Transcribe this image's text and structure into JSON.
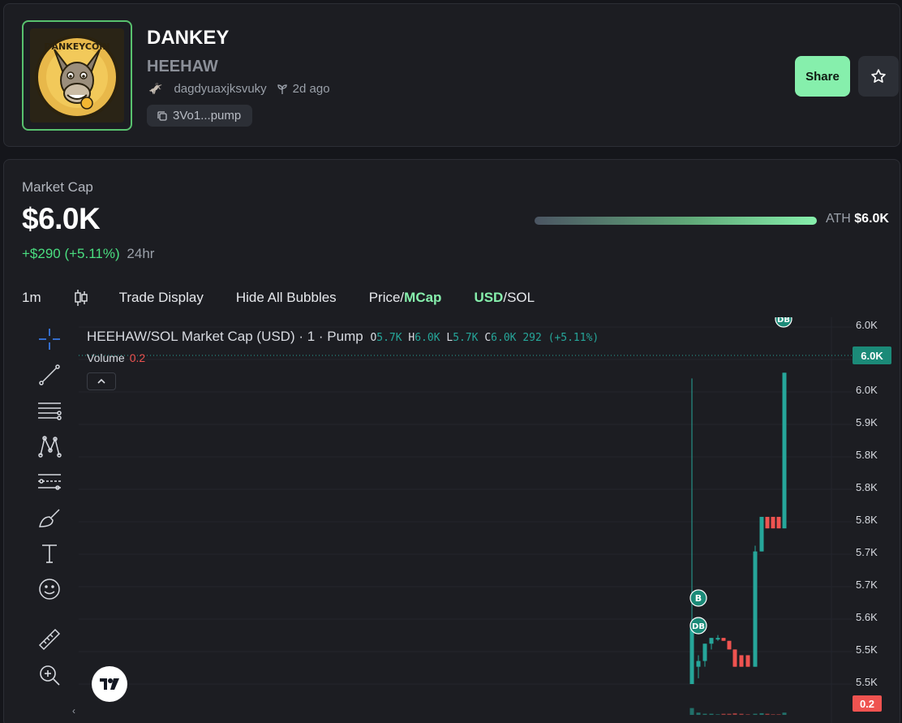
{
  "token": {
    "name": "DANKEY",
    "ticker": "HEEHAW",
    "creator": "dagdyuaxjksvuky",
    "age": "2d ago",
    "contract": "3Vo1...pump",
    "share_label": "Share",
    "avatar_text": "DANKEYCOIN"
  },
  "market": {
    "label": "Market Cap",
    "value": "$6.0K",
    "change": "+$290 (+5.11%)",
    "period": "24hr",
    "ath_label": "ATH",
    "ath_value": "$6.0K",
    "ath_progress": 1.0
  },
  "toolbar": {
    "interval": "1m",
    "trade_display": "Trade Display",
    "hide_bubbles": "Hide All Bubbles",
    "price_label": "Price/",
    "mcap_label": "MCap",
    "usd_label": "USD",
    "sol_label": "/SOL"
  },
  "chart_header": {
    "title": "HEEHAW/SOL Market Cap (USD) · 1 · Pump",
    "o_key": "O",
    "o_val": "5.7K",
    "h_key": "H",
    "h_val": "6.0K",
    "l_key": "L",
    "l_val": "5.7K",
    "c_key": "C",
    "c_val": "6.0K",
    "change": "292 (+5.11%)",
    "volume_label": "Volume",
    "volume_value": "0.2"
  },
  "price_scale": {
    "ticks": [
      "6.0K",
      "6.0K",
      "6.0K",
      "5.9K",
      "5.8K",
      "5.8K",
      "5.8K",
      "5.7K",
      "5.7K",
      "5.6K",
      "5.5K",
      "5.5K"
    ],
    "last_price": "6.0K",
    "last_volume": "0.2"
  },
  "bubbles": [
    {
      "label": "DB"
    },
    {
      "label": "B"
    },
    {
      "label": "DB"
    }
  ],
  "colors": {
    "up": "#26a69a",
    "down": "#ef5350",
    "accent": "#86efac",
    "background": "#15161b",
    "panel": "#1c1d22"
  },
  "icons": [
    "crosshair-icon",
    "trend-line-icon",
    "fib-icon",
    "pattern-icon",
    "forecast-icon",
    "brush-icon",
    "text-icon",
    "emoji-icon",
    "ruler-icon",
    "zoom-in-icon",
    "candles-icon",
    "star-icon",
    "copy-icon",
    "sprout-icon",
    "collapse-icon"
  ],
  "chart_data": {
    "type": "candlestick",
    "title": "HEEHAW/SOL Market Cap (USD) · 1 · Pump",
    "ylim": [
      5.46,
      6.03
    ],
    "candles": [
      {
        "o": 5.46,
        "h": 5.99,
        "l": 5.46,
        "c": 5.56
      },
      {
        "o": 5.49,
        "h": 5.51,
        "l": 5.47,
        "c": 5.5
      },
      {
        "o": 5.5,
        "h": 5.53,
        "l": 5.49,
        "c": 5.53
      },
      {
        "o": 5.53,
        "h": 5.54,
        "l": 5.52,
        "c": 5.54
      },
      {
        "o": 5.54,
        "h": 5.545,
        "l": 5.535,
        "c": 5.54
      },
      {
        "o": 5.54,
        "h": 5.54,
        "l": 5.535,
        "c": 5.535
      },
      {
        "o": 5.535,
        "h": 5.535,
        "l": 5.52,
        "c": 5.52
      },
      {
        "o": 5.52,
        "h": 5.52,
        "l": 5.49,
        "c": 5.49
      },
      {
        "o": 5.51,
        "h": 5.51,
        "l": 5.49,
        "c": 5.49
      },
      {
        "o": 5.51,
        "h": 5.51,
        "l": 5.49,
        "c": 5.49
      },
      {
        "o": 5.49,
        "h": 5.7,
        "l": 5.49,
        "c": 5.69
      },
      {
        "o": 5.69,
        "h": 5.75,
        "l": 5.69,
        "c": 5.75
      },
      {
        "o": 5.75,
        "h": 5.75,
        "l": 5.73,
        "c": 5.73
      },
      {
        "o": 5.75,
        "h": 5.75,
        "l": 5.73,
        "c": 5.73
      },
      {
        "o": 5.75,
        "h": 5.75,
        "l": 5.73,
        "c": 5.73
      },
      {
        "o": 5.73,
        "h": 6.0,
        "l": 5.73,
        "c": 6.0
      }
    ],
    "volumes": [
      0.6,
      0.2,
      0.1,
      0.1,
      0.05,
      0.1,
      0.1,
      0.15,
      0.1,
      0.05,
      0.1,
      0.15,
      0.1,
      0.05,
      0.05,
      0.2
    ]
  }
}
